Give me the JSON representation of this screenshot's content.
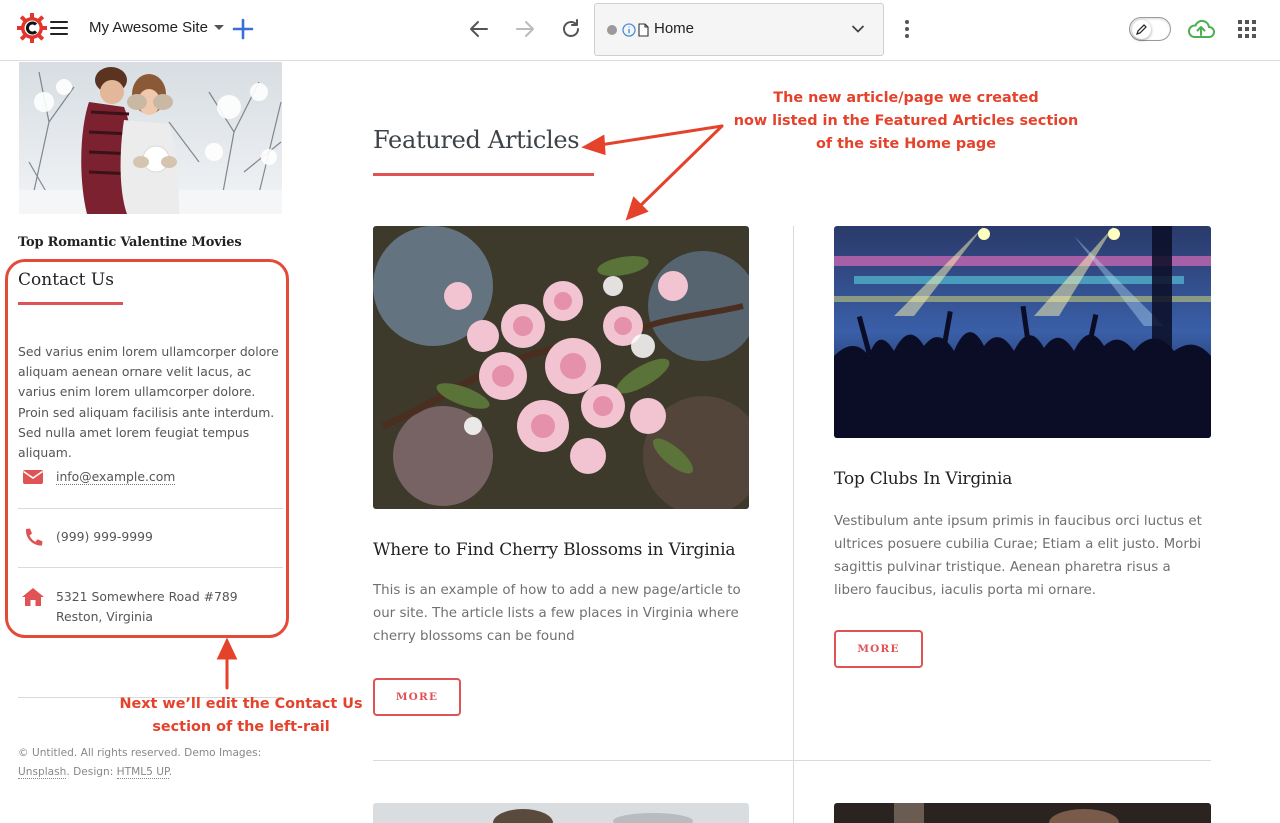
{
  "toolbar": {
    "site_name": "My Awesome Site",
    "address_text": "Home",
    "brand_color": "#e0362c",
    "plus_color": "#3b6fd8",
    "cloud_color": "#4caf50"
  },
  "left_rail": {
    "photo_caption": "Top Romantic Valentine Movies",
    "contact": {
      "heading": "Contact Us",
      "body": "Sed varius enim lorem ullamcorper dolore aliquam aenean ornare velit lacus, ac varius enim lorem ullamcorper dolore. Proin sed aliquam facilisis ante interdum. Sed nulla amet lorem feugiat tempus aliquam.",
      "email": "info@example.com",
      "phone": "(999) 999-9999",
      "address_line1": "5321 Somewhere Road #789",
      "address_line2": "Reston, Virginia",
      "icons": [
        "envelope-icon",
        "phone-icon",
        "home-icon"
      ]
    },
    "footer": {
      "text_prefix": "© Untitled. All rights reserved. Demo Images:",
      "link1": "Unsplash",
      "mid": ". Design: ",
      "link2": "HTML5 UP",
      "suffix": "."
    }
  },
  "main": {
    "section_title": "Featured Articles",
    "accent_color": "#e05355",
    "articles": [
      {
        "title": "Where to Find Cherry Blossoms in Virginia",
        "description": "This is an example of how to add a new page/article to our site. The article lists a few places in Virginia where cherry blossoms can be found",
        "more_label": "MORE"
      },
      {
        "title": "Top Clubs In Virginia",
        "description": "Vestibulum ante ipsum primis in faucibus orci luctus et ultrices posuere cubilia Curae; Etiam a elit justo. Morbi sagittis pulvinar tristique. Aenean pharetra risus a libero faucibus, iaculis porta mi ornare.",
        "more_label": "MORE"
      }
    ]
  },
  "annotations": {
    "featured_line1": "The new article/page we created",
    "featured_line2": "now listed in the Featured Articles section",
    "featured_line3": "of the site Home page",
    "contact_line1": "Next we’ll edit the Contact Us",
    "contact_line2": "section of the left-rail",
    "color": "#e5422c"
  }
}
